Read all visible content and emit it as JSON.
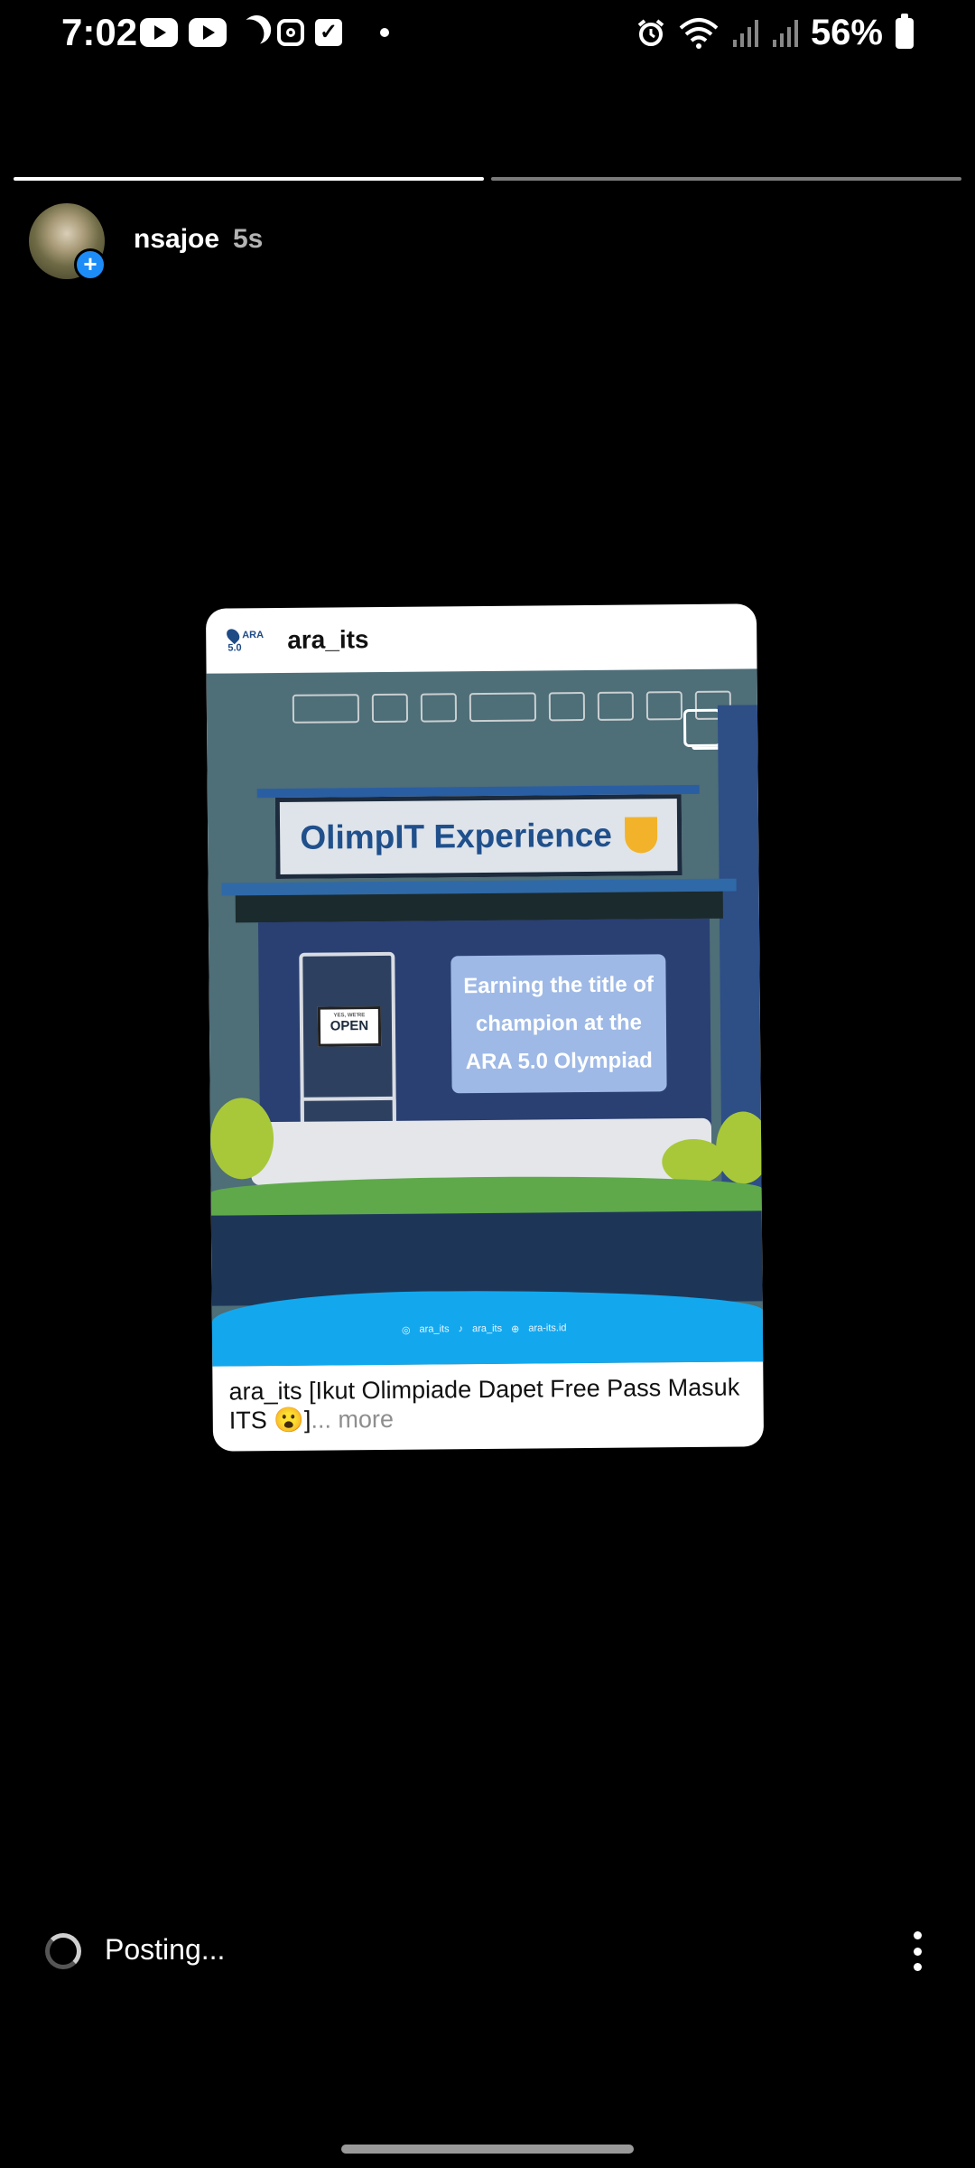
{
  "status_bar": {
    "time": "7:02",
    "battery": "56%",
    "icons_left": [
      "youtube-icon",
      "youtube-icon",
      "moon-icon",
      "instagram-icon",
      "checkbox-icon",
      "dot-icon"
    ],
    "icons_right": [
      "alarm-icon",
      "wifi-icon",
      "signal-icon",
      "signal-icon",
      "battery-icon"
    ]
  },
  "story": {
    "progress_segments": 2,
    "active_segment": 1,
    "username": "nsajoe",
    "time_ago": "5s",
    "add_icon": "+"
  },
  "shared_post": {
    "author": "ara_its",
    "logo_text": "ARA 5.0",
    "image": {
      "title": "OlimpIT Experience",
      "door_sign_small": "YES, WE'RE",
      "door_sign": "OPEN",
      "window_text": "Earning the title of champion at the ARA 5.0 Olympiad",
      "social_instagram": "ara_its",
      "social_tiktok": "ara_its",
      "social_web": "ara-its.id"
    },
    "caption_user": "ara_its",
    "caption_text": "[Ikut Olimpiade Dapet Free Pass Masuk ITS 😮]",
    "more_label": "... more"
  },
  "bottom_bar": {
    "status_label": "Posting...",
    "menu_icon": "kebab-menu-icon"
  },
  "colors": {
    "background": "#000000",
    "accent_blue": "#1d8cf6",
    "post_title_blue": "#20508c"
  }
}
